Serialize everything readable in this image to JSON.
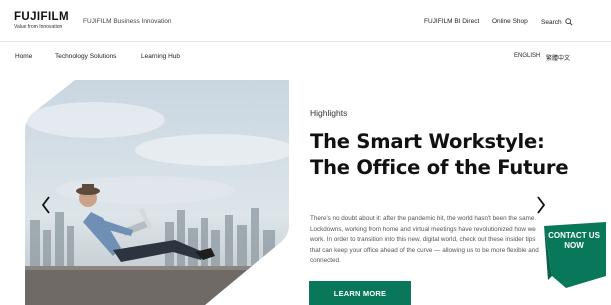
{
  "header": {
    "logo_word": "FUJIFILM",
    "logo_tagline": "Value from Innovation",
    "business_name": "FUJIFILM Business Innovation",
    "links": {
      "bi_direct": "FUJIFILM BI Direct",
      "online_shop": "Online Shop",
      "search": "Search"
    }
  },
  "nav": {
    "home": "Home",
    "technology": "Technology Solutions",
    "learning": "Learning Hub"
  },
  "language": {
    "english": "ENGLISH",
    "chinese": "繁體中文"
  },
  "hero": {
    "eyebrow": "Highlights",
    "headline": "The Smart Workstyle: The Office of the Future",
    "body": "There's no doubt about it: after the pandemic hit, the world hasn't been the same. Lockdowns, working from home and virtual meetings have revolutionized how we work. In order to transition into this new, digital world, check out these insider tips that can keep your office ahead of the curve — allowing us to be more flexible and connected.",
    "cta": "LEARN MORE"
  },
  "contact": {
    "label": "CONTACT US NOW",
    "color": "#08775a"
  },
  "colors": {
    "brand_red": "#d7001c",
    "brand_green": "#08775a"
  },
  "icons": {
    "search": "search-icon",
    "prev": "chevron-left-icon",
    "next": "chevron-right-icon"
  }
}
